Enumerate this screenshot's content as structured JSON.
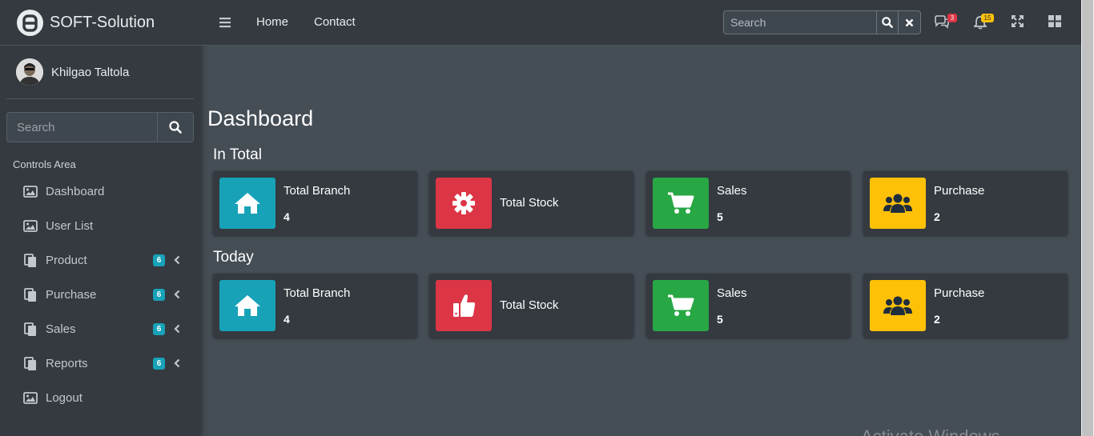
{
  "brand": {
    "name": "SOFT-Solution",
    "logo_icon": "brand-logo-icon"
  },
  "user": {
    "name": "Khilgao Taltola"
  },
  "sidebar_search": {
    "placeholder": "Search"
  },
  "nav": {
    "header": "Controls Area",
    "items": [
      {
        "label": "Dashboard",
        "icon": "image-icon",
        "badge": "",
        "expandable": false
      },
      {
        "label": "User List",
        "icon": "image-icon",
        "badge": "",
        "expandable": false
      },
      {
        "label": "Product",
        "icon": "copy-icon",
        "badge": "6",
        "expandable": true
      },
      {
        "label": "Purchase",
        "icon": "copy-icon",
        "badge": "6",
        "expandable": true
      },
      {
        "label": "Sales",
        "icon": "copy-icon",
        "badge": "6",
        "expandable": true
      },
      {
        "label": "Reports",
        "icon": "copy-icon",
        "badge": "6",
        "expandable": true
      },
      {
        "label": "Logout",
        "icon": "image-icon",
        "badge": "",
        "expandable": false
      }
    ]
  },
  "topbar": {
    "links": [
      "Home",
      "Contact"
    ],
    "search_placeholder": "Search",
    "messages_badge": "3",
    "notifications_badge": "15"
  },
  "page": {
    "title": "Dashboard",
    "sections": [
      {
        "title": "In Total",
        "cards": [
          {
            "title": "Total Branch",
            "value": "4",
            "icon": "home-icon",
            "color": "#17a2b8"
          },
          {
            "title": "Total Stock",
            "value": "",
            "icon": "gear-icon",
            "color": "#dc3545"
          },
          {
            "title": "Sales",
            "value": "5",
            "icon": "cart-icon",
            "color": "#28a745"
          },
          {
            "title": "Purchase",
            "value": "2",
            "icon": "users-icon",
            "color": "#ffc107"
          }
        ]
      },
      {
        "title": "Today",
        "cards": [
          {
            "title": "Total Branch",
            "value": "4",
            "icon": "home-icon",
            "color": "#17a2b8"
          },
          {
            "title": "Total Stock",
            "value": "",
            "icon": "thumbs-up-icon",
            "color": "#dc3545"
          },
          {
            "title": "Sales",
            "value": "5",
            "icon": "cart-icon",
            "color": "#28a745"
          },
          {
            "title": "Purchase",
            "value": "2",
            "icon": "users-icon",
            "color": "#ffc107"
          }
        ]
      }
    ]
  },
  "watermark": "Activate Windows",
  "colors": {
    "sidebar": "#343a40",
    "content": "#454d55",
    "info": "#17a2b8",
    "danger": "#dc3545",
    "success": "#28a745",
    "warning": "#ffc107"
  }
}
